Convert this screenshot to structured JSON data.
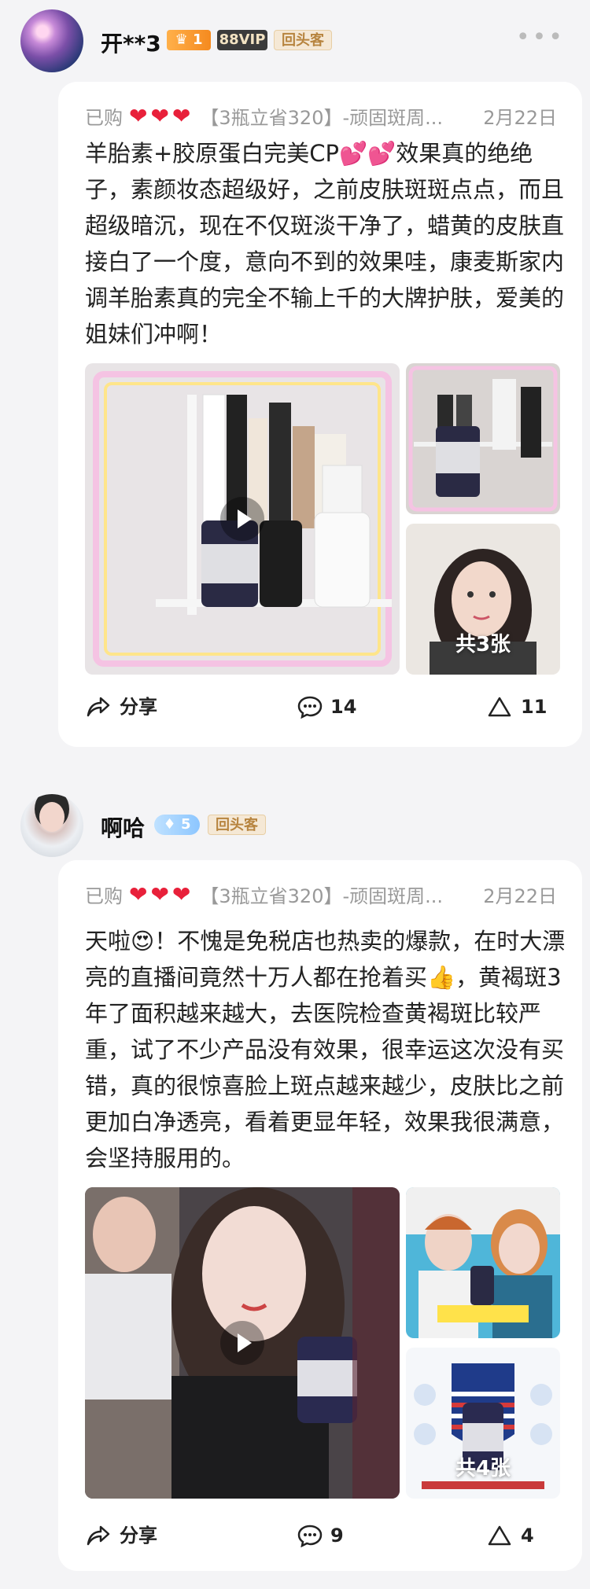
{
  "reviews": [
    {
      "user": {
        "name": "开**3",
        "level_badge": "1",
        "vip_badge": "88VIP",
        "repeat_badge": "回头客"
      },
      "meta": {
        "purchased": "已购",
        "hearts": "❤❤❤",
        "product": "【3瓶立省320】-顽固斑周...",
        "date": "2月22日"
      },
      "content": "羊胎素+胶原蛋白完美CP💕💕效果真的绝绝子，素颜妆态超级好，之前皮肤斑斑点点，而且超级暗沉，现在不仅斑淡干净了，蜡黄的皮肤直接白了一个度，意向不到的效果哇，康麦斯家内调羊胎素真的完全不输上千的大牌护肤，爱美的姐妹们冲啊！",
      "image_count": "共3张",
      "share_label": "分享",
      "comment_count": "14",
      "like_count": "11"
    },
    {
      "user": {
        "name": "啊哈",
        "diamond_badge": "5",
        "repeat_badge": "回头客"
      },
      "meta": {
        "purchased": "已购",
        "hearts": "❤❤❤",
        "product": "【3瓶立省320】-顽固斑周...",
        "date": "2月22日"
      },
      "content": "天啦😍！不愧是免税店也热卖的爆款，在时大漂亮的直播间竟然十万人都在抢着买👍，黄褐斑3年了面积越来越大，去医院检查黄褐斑比较严重，试了不少产品没有效果，很幸运这次没有买错，真的很惊喜脸上斑点越来越少，皮肤比之前更加白净透亮，看着更显年轻，效果我很满意，会坚持服用的。",
      "image_count": "共4张",
      "share_label": "分享",
      "comment_count": "9",
      "like_count": "4"
    }
  ],
  "colors": {
    "heart": "#e8203a",
    "meta_gray": "#999999",
    "card_bg": "#ffffff",
    "page_bg": "#f4f4f6"
  }
}
